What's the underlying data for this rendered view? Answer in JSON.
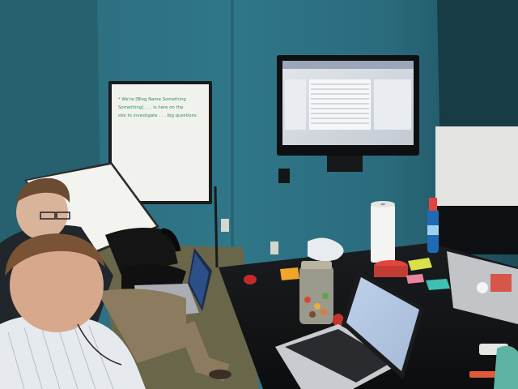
{
  "scene": {
    "type": "photo",
    "colors": {
      "wall": "#2f7385",
      "wall_shadow": "#1f4f5d",
      "table": "#151719",
      "floor": "#6f6a4f",
      "whiteboard": "#f1f2ee",
      "monitor_screen": "#d8dde6",
      "laptop_silver": "#c9cbd0",
      "sticky_orange": "#f2a42b",
      "sticky_yellow": "#d9e04a",
      "sticky_pink": "#e7869c",
      "sticky_teal": "#3ec0b2",
      "cap_red": "#e2453d",
      "bottle_blue": "#1f6ab4"
    },
    "whiteboard_text": [
      "* We're [Blog Name Something",
      "Something] . . . is here on the",
      "site to investigate . . . big questions"
    ]
  }
}
